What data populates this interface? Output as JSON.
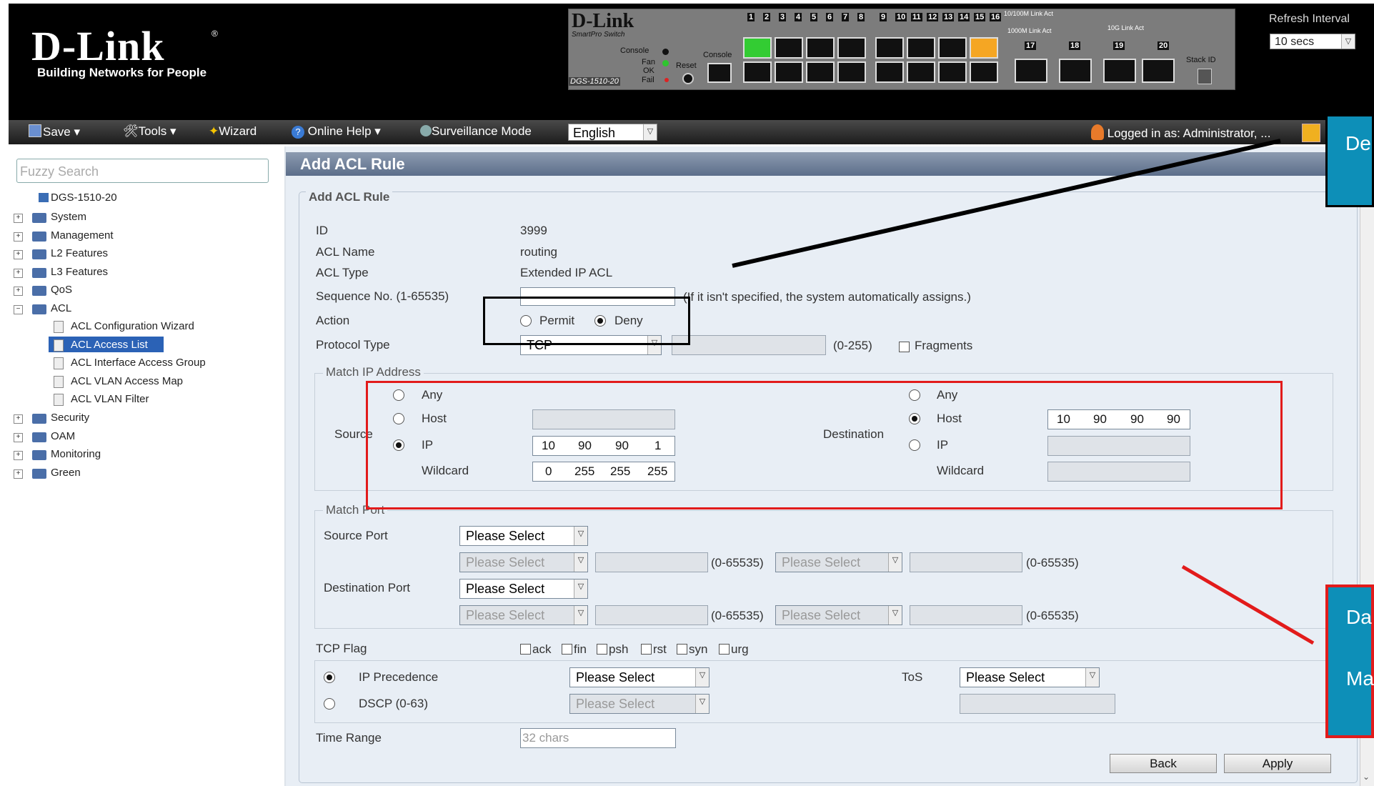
{
  "header": {
    "logo": "D-Link",
    "tagline": "Building Networks for People",
    "panel": {
      "brand": "D-Link",
      "sub": "SmartPro Switch",
      "model": "DGS-1510-20",
      "console": "Console",
      "fan": "Fan",
      "ok": "OK",
      "fail": "Fail",
      "reset": "Reset",
      "console2": "Console",
      "stack_id": "Stack ID",
      "legend_1": "10/100M Link Act",
      "legend_2": "1000M Link Act",
      "legend_3": "10G Link Act",
      "ports_1": [
        "1",
        "2",
        "3",
        "4",
        "5",
        "6",
        "7",
        "8"
      ],
      "ports_2": [
        "9",
        "10",
        "11",
        "12",
        "13",
        "14",
        "15",
        "16"
      ],
      "sfp_ports": [
        "17",
        "18",
        "19",
        "20"
      ]
    },
    "refresh_label": "Refresh Interval",
    "refresh_value": "10 secs"
  },
  "menubar": {
    "save": "Save",
    "tools": "Tools",
    "wizard": "Wizard",
    "help": "Online Help",
    "surveillance": "Surveillance Mode",
    "language": "English",
    "logged_in": "Logged in as: Administrator, ..."
  },
  "sidebar": {
    "search_placeholder": "Fuzzy Search",
    "root": "DGS-1510-20",
    "items": [
      "System",
      "Management",
      "L2 Features",
      "L3 Features",
      "QoS",
      "ACL"
    ],
    "acl_children": [
      "ACL Configuration Wizard",
      "ACL Access List",
      "ACL Interface Access Group",
      "ACL VLAN Access Map",
      "ACL VLAN Filter"
    ],
    "items_after": [
      "Security",
      "OAM",
      "Monitoring",
      "Green"
    ]
  },
  "content": {
    "title": "Add ACL Rule",
    "legend": "Add ACL Rule",
    "id_label": "ID",
    "id_value": "3999",
    "name_label": "ACL Name",
    "name_value": "routing",
    "type_label": "ACL Type",
    "type_value": "Extended IP ACL",
    "seq_label": "Sequence No. (1-65535)",
    "seq_hint": "(If it isn't specified, the system automatically assigns.)",
    "action_label": "Action",
    "permit": "Permit",
    "deny": "Deny",
    "protocol_label": "Protocol Type",
    "protocol_value": "TCP",
    "protocol_range": "(0-255)",
    "fragments": "Fragments",
    "match_ip": {
      "legend": "Match IP Address",
      "any": "Any",
      "host": "Host",
      "ip": "IP",
      "wildcard": "Wildcard",
      "source": "Source",
      "destination": "Destination",
      "src_ip": [
        "10",
        "90",
        "90",
        "1"
      ],
      "src_wildcard": [
        "0",
        "255",
        "255",
        "255"
      ],
      "dst_host": [
        "10",
        "90",
        "90",
        "90"
      ]
    },
    "match_port": {
      "legend": "Match Port",
      "source_port": "Source Port",
      "dest_port": "Destination Port",
      "please_select": "Please Select",
      "range": "(0-65535)"
    },
    "tcp_flag": {
      "label": "TCP Flag",
      "flags": [
        "ack",
        "fin",
        "psh",
        "rst",
        "syn",
        "urg"
      ]
    },
    "ip_precedence": "IP Precedence",
    "dscp": "DSCP (0-63)",
    "tos": "ToS",
    "time_range": "Time Range",
    "time_placeholder": "32 chars",
    "back": "Back",
    "apply": "Apply"
  },
  "annotations": {
    "callout_top": "De",
    "callout_bottom_1": "Da",
    "callout_bottom_2": "Ma"
  },
  "colors": {
    "header_bg": "#000000",
    "content_bg": "#e8eef5",
    "selected": "#2b62b6",
    "annotation_red": "#e21b1b",
    "callout": "#0d8fb8"
  }
}
